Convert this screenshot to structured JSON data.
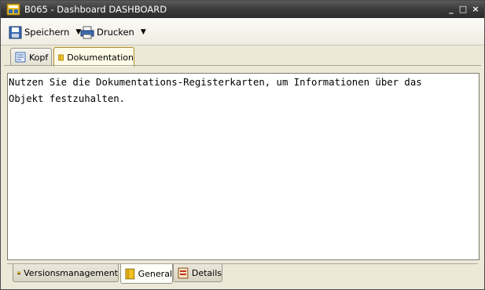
{
  "window": {
    "title": "B065 - Dashboard DASHBOARD",
    "controls": {
      "minimize": "_",
      "maximize": "□",
      "close": "×"
    }
  },
  "toolbar": {
    "save_label": "Speichern",
    "print_label": "Drucken",
    "dropdown_glyph": "▼"
  },
  "tabs_top": [
    {
      "label": "Kopf",
      "icon": "header-icon",
      "active": false
    },
    {
      "label": "Dokumentation",
      "icon": "documentation-icon",
      "active": true
    }
  ],
  "document": {
    "text": "Nutzen Sie die Dokumentations-Registerkarten, um Informationen über das\nObjekt festzuhalten."
  },
  "tabs_bottom": [
    {
      "label": "Versionsmanagement",
      "icon": "version-management-icon",
      "active": false
    },
    {
      "label": "General",
      "icon": "general-icon",
      "active": true
    },
    {
      "label": "Details",
      "icon": "details-icon",
      "active": false
    }
  ],
  "colors": {
    "titlebar": "#3a3a3a",
    "active_tab_border": "#b08a2a",
    "icon_yellow": "#f0c020",
    "icon_blue": "#3a6ab0"
  }
}
